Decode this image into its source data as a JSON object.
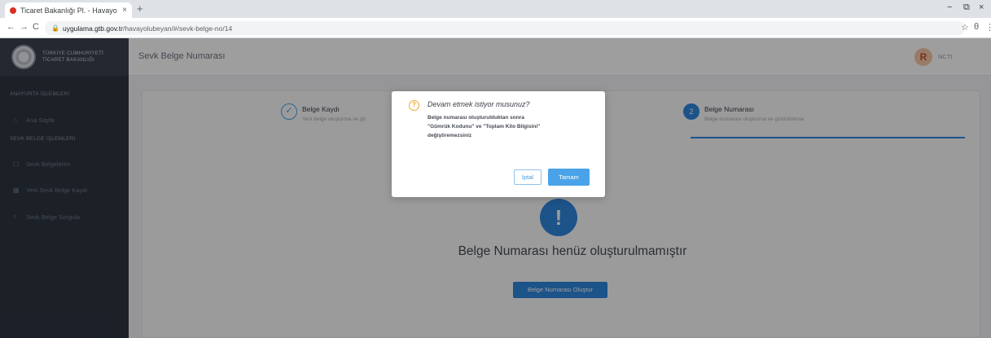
{
  "browser": {
    "tab_title": "Ticaret Bakanlığı Pl. - Havayo",
    "tab_close": "×",
    "new_tab": "+",
    "url_host": "uygulama.gtb.gov.tr",
    "url_path": "/havayolubeyan/#/sevk-belge-no/14",
    "nav_back": "←",
    "nav_forward": "→",
    "nav_reload": "C",
    "star": "☆",
    "profile": "θ",
    "menu": "⋮",
    "minimize": "−",
    "maximize": "⧉",
    "close": "×"
  },
  "sidebar": {
    "logo_line1": "TÜRKİYE CUMHURİYETİ",
    "logo_line2": "TİCARET BAKANLIĞI",
    "section1": "ANAYURTA İŞLEMLERİ",
    "section2": "SEVK BELGE İŞLEMLERİ",
    "items": [
      {
        "label": "Ana Sayfa",
        "icon": "⌂"
      },
      {
        "label": "Sevk Belgelerim",
        "icon": "☐"
      },
      {
        "label": "Yeni Sevk Belge Kaydı",
        "icon": "▦"
      },
      {
        "label": "Sevk Belge Sorgula",
        "icon": "⌕"
      }
    ]
  },
  "header": {
    "title": "Sevk Belge Numarası",
    "avatar_letter": "R",
    "username": "NCTI"
  },
  "steps": [
    {
      "title": "Belge Kaydı",
      "subtitle": "Yeni belge oluşturma ve gö",
      "mark": "✓"
    },
    {
      "title": "Belge Numarası",
      "subtitle": "Belge numarası oluşturma ve görüntüleme",
      "mark": "2"
    }
  ],
  "main": {
    "badge": "!",
    "empty_message": "Belge Numarası henüz oluşturulmamıştır",
    "create_button": "Belge Numarası Oluştur"
  },
  "dialog": {
    "icon": "?",
    "title": "Devam etmek istiyor musunuz?",
    "line1": "Belge numarası oluşturulduktan sonra",
    "line2": "\"Gümrük Kodunu\" ve \"Toplam Kilo Bilgisini\"",
    "line3": "değiştiremezsiniz",
    "cancel": "İptal",
    "ok": "Tamam"
  }
}
